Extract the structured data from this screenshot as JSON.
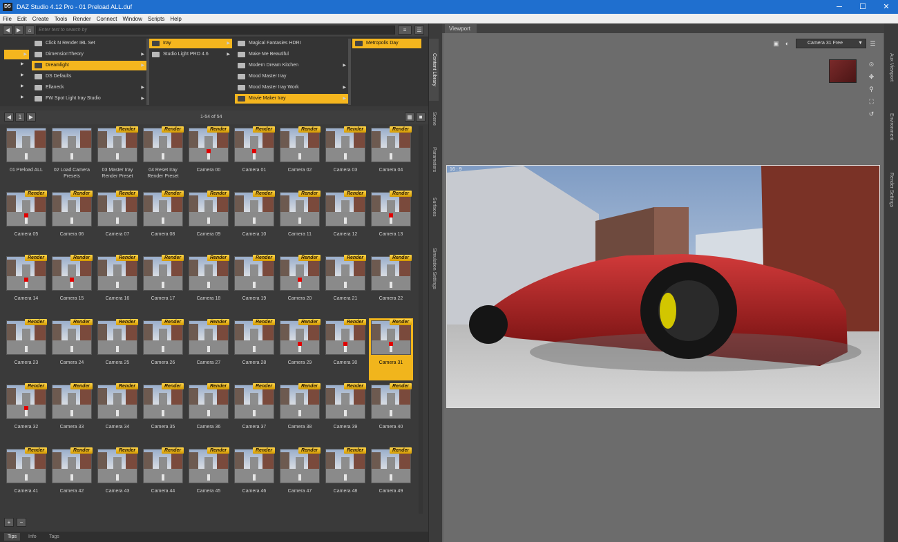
{
  "titlebar": {
    "app_icon": "DS",
    "title": "DAZ Studio 4.12 Pro - 01 Preload ALL.duf",
    "minimize": "─",
    "maximize": "☐",
    "close": "✕"
  },
  "menu": [
    "File",
    "Edit",
    "Create",
    "Tools",
    "Render",
    "Connect",
    "Window",
    "Scripts",
    "Help"
  ],
  "content_library": {
    "search_placeholder": "Enter text to search by",
    "col1": [
      {
        "label": "Click N Render IBL Set",
        "selected": false
      },
      {
        "label": "DimensionTheory",
        "selected": false
      },
      {
        "label": "Dreamlight",
        "selected": true
      },
      {
        "label": "DS Defaults",
        "selected": false
      },
      {
        "label": "Ellaneck",
        "selected": false
      },
      {
        "label": "FW Spot Light Iray Studio",
        "selected": false
      }
    ],
    "col2": [
      {
        "label": "Iray",
        "selected": true
      },
      {
        "label": "Studio Light PRO 4.6",
        "selected": false
      }
    ],
    "col3": [
      {
        "label": "Magical Fantasies HDRI",
        "selected": false
      },
      {
        "label": "Make Me Beautiful",
        "selected": false
      },
      {
        "label": "Modern Dream Kitchen",
        "selected": false
      },
      {
        "label": "Mood Master Iray",
        "selected": false
      },
      {
        "label": "Mood Master Iray Work",
        "selected": false
      },
      {
        "label": "Movie Maker Iray",
        "selected": true
      }
    ],
    "col4": [
      {
        "label": "Metropolis Day",
        "selected": true
      }
    ],
    "page_number": "1",
    "page_range": "1-54 of 54",
    "badge_label": "Render",
    "items": [
      {
        "label": "01 Preload ALL",
        "badge": false,
        "car": false
      },
      {
        "label": "02 Load Camera Presets",
        "badge": false,
        "car": false
      },
      {
        "label": "03 Master Iray Render Preset",
        "badge": true,
        "car": false
      },
      {
        "label": "04 Reset Iray Render Preset",
        "badge": true,
        "car": false
      },
      {
        "label": "Camera 00",
        "badge": true,
        "car": true
      },
      {
        "label": "Camera 01",
        "badge": true,
        "car": true
      },
      {
        "label": "Camera 02",
        "badge": true,
        "car": false
      },
      {
        "label": "Camera 03",
        "badge": true,
        "car": false
      },
      {
        "label": "Camera 04",
        "badge": true,
        "car": false
      },
      {
        "label": "Camera 05",
        "badge": true,
        "car": true
      },
      {
        "label": "Camera 06",
        "badge": true,
        "car": false
      },
      {
        "label": "Camera 07",
        "badge": true,
        "car": false
      },
      {
        "label": "Camera 08",
        "badge": true,
        "car": false
      },
      {
        "label": "Camera 09",
        "badge": true,
        "car": false
      },
      {
        "label": "Camera 10",
        "badge": true,
        "car": false
      },
      {
        "label": "Camera 11",
        "badge": true,
        "car": false
      },
      {
        "label": "Camera 12",
        "badge": true,
        "car": false
      },
      {
        "label": "Camera 13",
        "badge": true,
        "car": true
      },
      {
        "label": "Camera 14",
        "badge": true,
        "car": true
      },
      {
        "label": "Camera 15",
        "badge": true,
        "car": true
      },
      {
        "label": "Camera 16",
        "badge": true,
        "car": false
      },
      {
        "label": "Camera 17",
        "badge": true,
        "car": false
      },
      {
        "label": "Camera 18",
        "badge": true,
        "car": false
      },
      {
        "label": "Camera 19",
        "badge": true,
        "car": false
      },
      {
        "label": "Camera 20",
        "badge": true,
        "car": true
      },
      {
        "label": "Camera 21",
        "badge": true,
        "car": false
      },
      {
        "label": "Camera 22",
        "badge": true,
        "car": false
      },
      {
        "label": "Camera 23",
        "badge": true,
        "car": false
      },
      {
        "label": "Camera 24",
        "badge": true,
        "car": false
      },
      {
        "label": "Camera 25",
        "badge": true,
        "car": false
      },
      {
        "label": "Camera 26",
        "badge": true,
        "car": false
      },
      {
        "label": "Camera 27",
        "badge": true,
        "car": false
      },
      {
        "label": "Camera 28",
        "badge": true,
        "car": false
      },
      {
        "label": "Camera 29",
        "badge": true,
        "car": true
      },
      {
        "label": "Camera 30",
        "badge": true,
        "car": true
      },
      {
        "label": "Camera 31",
        "badge": true,
        "car": true
      },
      {
        "label": "Camera 32",
        "badge": true,
        "car": true
      },
      {
        "label": "Camera 33",
        "badge": true,
        "car": false
      },
      {
        "label": "Camera 34",
        "badge": true,
        "car": false
      },
      {
        "label": "Camera 35",
        "badge": true,
        "car": false
      },
      {
        "label": "Camera 36",
        "badge": true,
        "car": false
      },
      {
        "label": "Camera 37",
        "badge": true,
        "car": false
      },
      {
        "label": "Camera 38",
        "badge": true,
        "car": false
      },
      {
        "label": "Camera 39",
        "badge": true,
        "car": false
      },
      {
        "label": "Camera 40",
        "badge": true,
        "car": false
      },
      {
        "label": "Camera 41",
        "badge": true,
        "car": false
      },
      {
        "label": "Camera 42",
        "badge": true,
        "car": false
      },
      {
        "label": "Camera 43",
        "badge": true,
        "car": false
      },
      {
        "label": "Camera 44",
        "badge": true,
        "car": false
      },
      {
        "label": "Camera 45",
        "badge": true,
        "car": false
      },
      {
        "label": "Camera 46",
        "badge": true,
        "car": false
      },
      {
        "label": "Camera 47",
        "badge": true,
        "car": false
      },
      {
        "label": "Camera 48",
        "badge": true,
        "car": false
      },
      {
        "label": "Camera 49",
        "badge": true,
        "car": false
      }
    ],
    "selected_item": "Camera 31",
    "add_label": "+",
    "remove_label": "−"
  },
  "bottom_tabs": [
    "Tips",
    "Info",
    "Tags"
  ],
  "left_side_tabs": [
    "Content Library",
    "Scene",
    "Parameters",
    "Surfaces",
    "Simulation Settings"
  ],
  "right_side_tabs": [
    "Aux Viewport",
    "Environment",
    "Render Settings"
  ],
  "viewport": {
    "tab_label": "Viewport",
    "camera": "Camera 31 Free",
    "render_label": "16 : 9"
  },
  "colors": {
    "accent": "#f5b61e",
    "titlebar": "#1f6fcf"
  }
}
